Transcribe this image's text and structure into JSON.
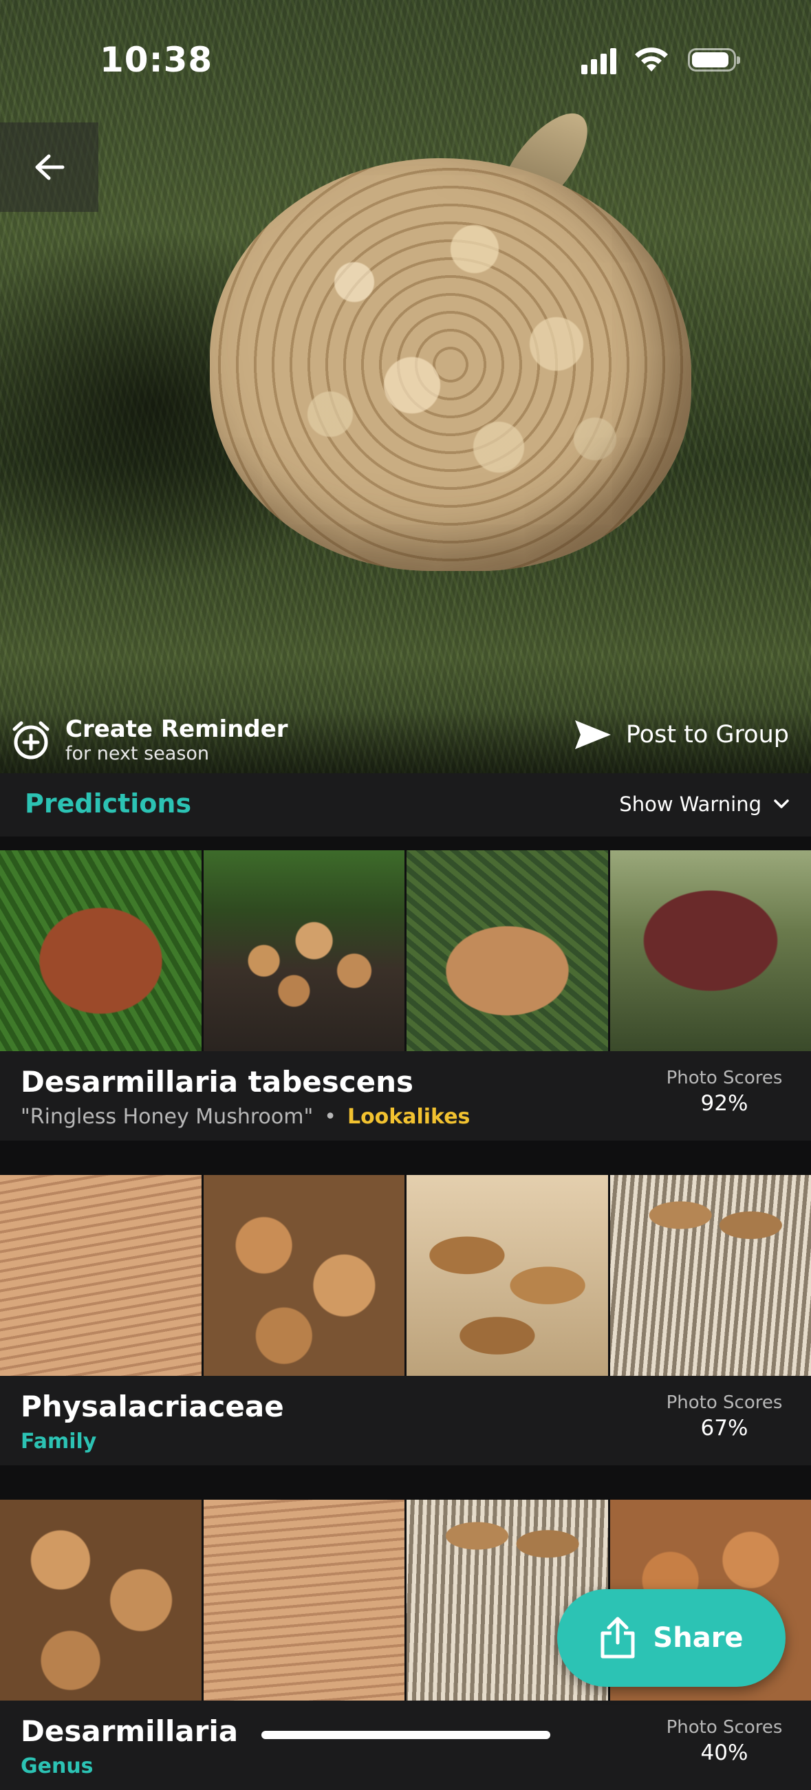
{
  "status": {
    "time": "10:38"
  },
  "hero": {
    "reminder_title": "Create Reminder",
    "reminder_sub": "for next season",
    "post_label": "Post to Group"
  },
  "predictions": {
    "title": "Predictions",
    "show_warning": "Show Warning",
    "items": [
      {
        "name": "Desarmillaria tabescens",
        "common": "\"Ringless Honey Mushroom\"",
        "sep": "•",
        "lookalikes": "Lookalikes",
        "score_label": "Photo Scores",
        "score": "92%"
      },
      {
        "name": "Physalacriaceae",
        "rank": "Family",
        "score_label": "Photo Scores",
        "score": "67%"
      },
      {
        "name": "Desarmillaria",
        "rank": "Genus",
        "score_label": "Photo Scores",
        "score": "40%"
      }
    ]
  },
  "share": {
    "label": "Share"
  },
  "colors": {
    "accent": "#2cc3b4",
    "lookalike": "#f2c230",
    "background": "#0f0f10",
    "panel": "#1b1b1c"
  },
  "icons": [
    "back-arrow-icon",
    "alarm-plus-icon",
    "send-icon",
    "chevron-down-icon",
    "share-icon"
  ]
}
